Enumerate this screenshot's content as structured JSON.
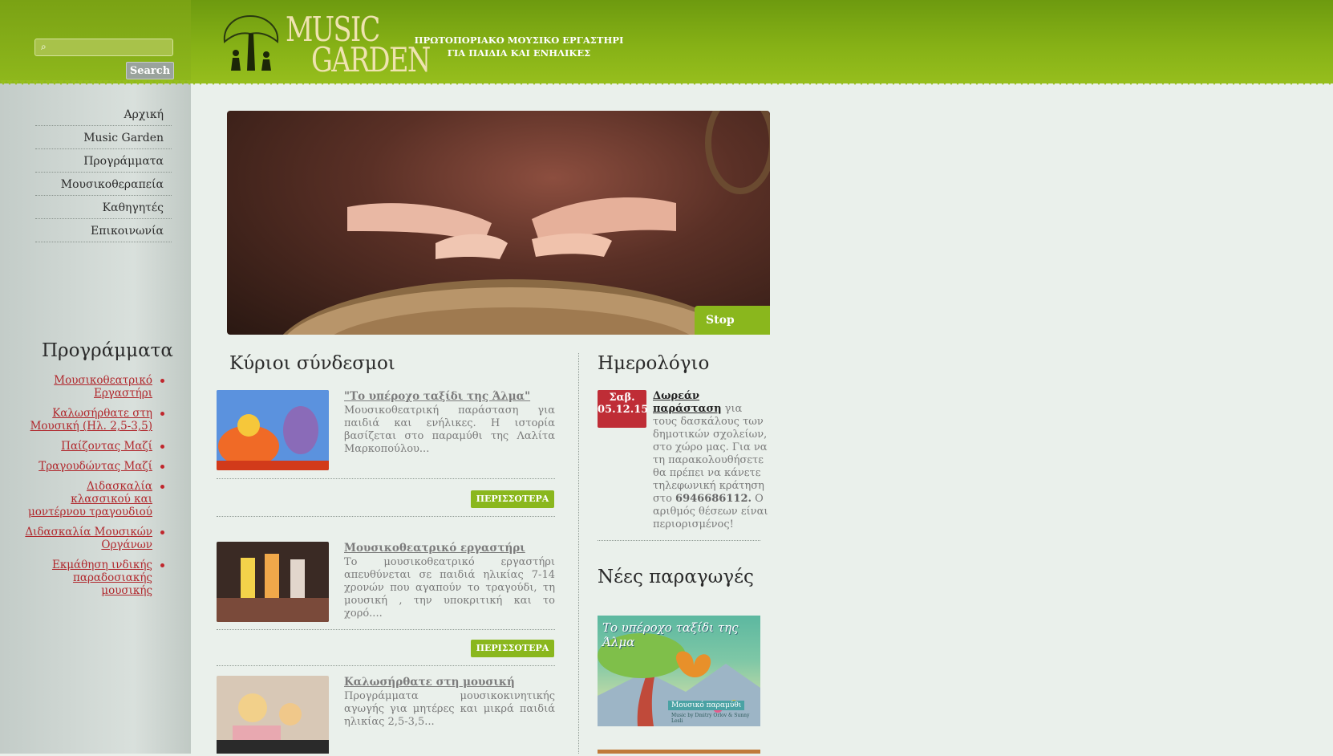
{
  "search": {
    "button_label": "Search",
    "placeholder": ""
  },
  "nav": {
    "items": [
      {
        "label": "Αρχική"
      },
      {
        "label": "Music Garden"
      },
      {
        "label": "Προγράμματα"
      },
      {
        "label": "Μουσικοθεραπεία"
      },
      {
        "label": "Καθηγητές"
      },
      {
        "label": "Επικοινωνία"
      }
    ]
  },
  "sidebar_programs": {
    "title": "Προγράμματα",
    "items": [
      {
        "label": "Μουσικοθεατρικό Εργαστήρι"
      },
      {
        "label": "Καλωσήρθατε στη Μουσική (Ηλ. 2,5-3,5)"
      },
      {
        "label": "Παίζοντας Μαζί"
      },
      {
        "label": "Τραγουδώντας Μαζί"
      },
      {
        "label": "Διδασκαλία κλασσικού και μοντέρνου τραγουδιού"
      },
      {
        "label": "Διδασκαλία Μουσικών Οργάνων"
      },
      {
        "label": "Εκμάθηση ινδικής παραδοσιακής μουσικής"
      }
    ]
  },
  "header": {
    "logo_line1": "MUSIC",
    "logo_line2": "GARDEN",
    "tagline_line1": "ΠΡΩΤΟΠΟΡΙΑΚΟ ΜΟΥΣΙΚΟ ΕΡΓΑΣΤΗΡΙ",
    "tagline_line2": "ΓΙΑ ΠΑΙΔΙΑ ΚΑΙ ΕΝΗΛΙΚΕΣ"
  },
  "slideshow": {
    "stop_label": "Stop"
  },
  "main_links": {
    "title": "Κύριοι σύνδεσμοι",
    "more_label": "ΠΕΡΙΣΣΟΤΕΡΑ",
    "articles": [
      {
        "title": "\"Το υπέροχο ταξίδι της Άλμα\"",
        "text": "Μουσικοθεατρική παράσταση για παιδιά και ενήλικες. Η ιστορία βασίζεται στο παραμύθι της Λαλίτα Μαρκοπούλου..."
      },
      {
        "title": "Μουσικοθεατρικό εργαστήρι",
        "text": "Το μουσικοθεατρικό εργαστήρι απευθύνεται σε παιδιά ηλικίας 7-14 χρονών που αγαπούν το τραγούδι, τη μουσική , την υποκριτική και το χορό...."
      },
      {
        "title": "Καλωσήρθατε στη μουσική",
        "text": "Προγράμματα μουσικοκινητικής αγωγής για μητέρες και μικρά παιδιά ηλικίας 2,5-3,5..."
      }
    ]
  },
  "calendar": {
    "title": "Ημερολόγιο",
    "event": {
      "day": "Σαβ.",
      "date": "05.12.15",
      "link": "Δωρεάν παράσταση",
      "text_before": " για τους δασκάλους των δημοτικών σχολείων, στο χώρο μας. Για να τη παρακολουθήσετε θα πρέπει να κάνετε τηλεφωνική κράτηση στο ",
      "phone": "6946686112.",
      "text_after": " Ο αριθμός θέσεων είναι περιορισμένος!"
    }
  },
  "new_productions": {
    "title": "Νέες παραγωγές",
    "item_title": "Το υπέροχο ταξίδι της Άλμα",
    "item_caption": "Μουσικό παραμύθι",
    "item_credit": "Music by Dmitry Orlov & Sunny Lesli"
  },
  "colors": {
    "accent_green": "#8ab71d",
    "link_red": "#b0272c",
    "calendar_red": "#bf2d36"
  }
}
